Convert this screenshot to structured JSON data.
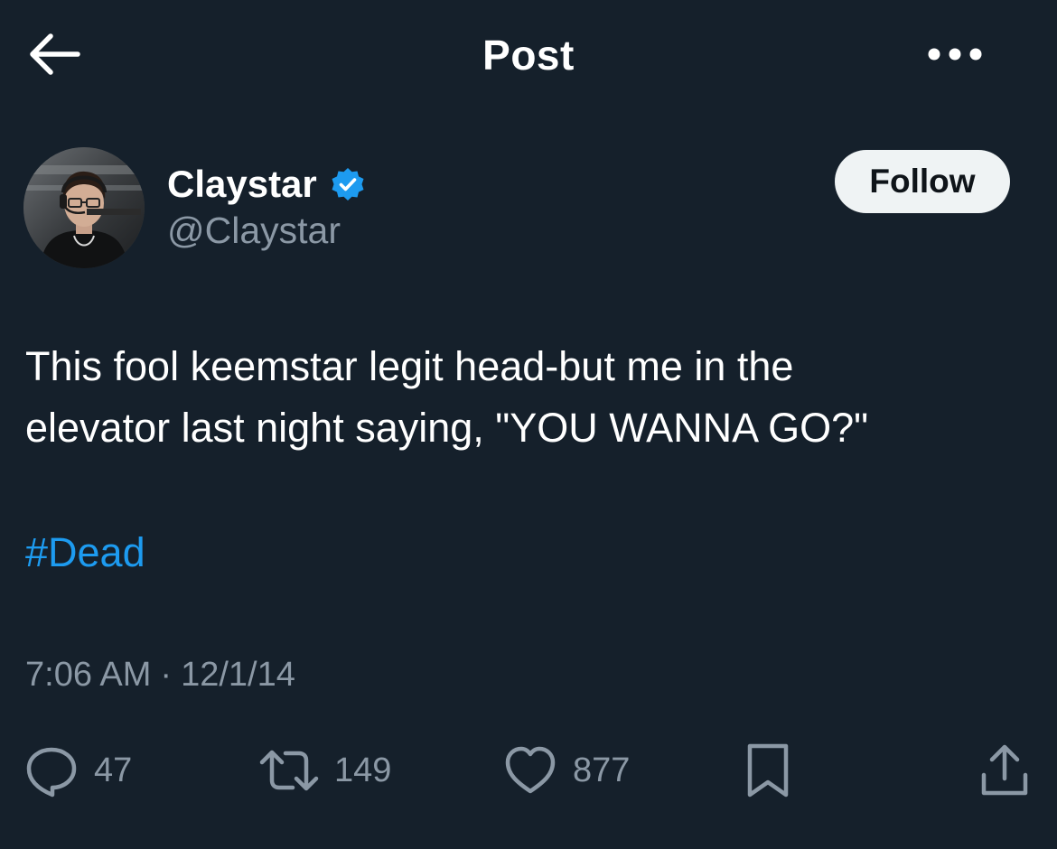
{
  "header": {
    "title": "Post"
  },
  "author": {
    "name": "Claystar",
    "handle": "@Claystar",
    "verified": true,
    "verified_color": "#1d9bf0"
  },
  "follow_button": {
    "label": "Follow"
  },
  "tweet": {
    "lines": [
      "This fool keemstar legit head-but me in the",
      "elevator last night saying, \"YOU WANNA GO?\""
    ],
    "hashtag": "#Dead",
    "time": "7:06 AM",
    "separator": "·",
    "date": "12/1/14"
  },
  "actions": {
    "replies": "47",
    "reposts": "149",
    "likes": "877"
  },
  "icons": {
    "back": "arrow-left-icon",
    "more": "more-horizontal-icon",
    "reply": "chat-bubble-icon",
    "repost": "repost-icon",
    "like": "heart-icon",
    "bookmark": "bookmark-icon",
    "share": "share-icon"
  },
  "colors": {
    "background": "#15202b",
    "secondary_text": "#8b98a5",
    "link": "#1d9bf0",
    "follow_button_bg": "#eff3f4"
  }
}
